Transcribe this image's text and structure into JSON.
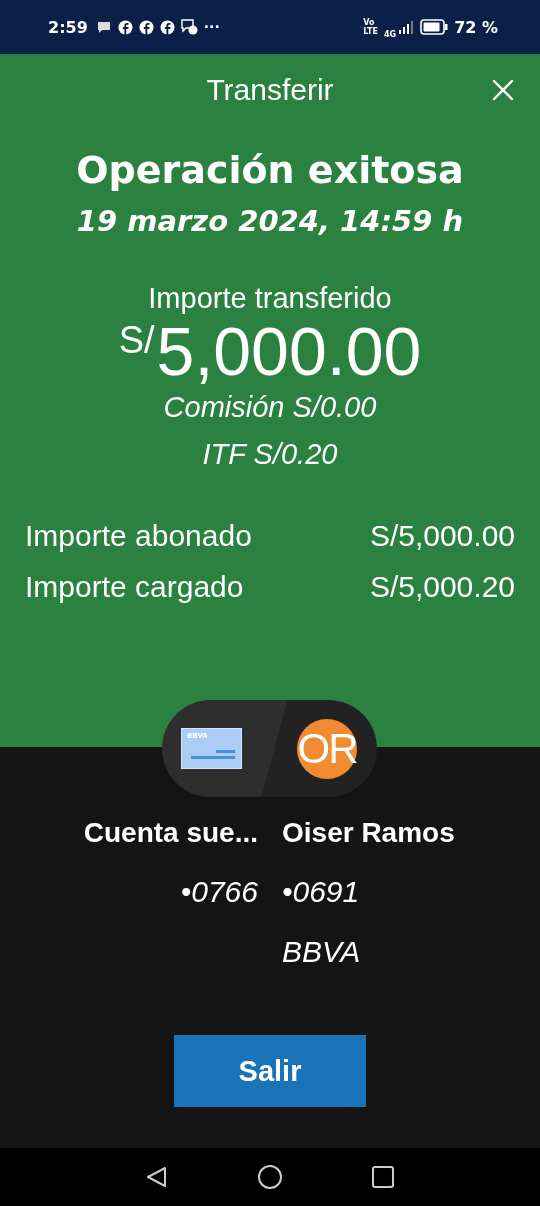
{
  "status_bar": {
    "time": "2:59",
    "more": "···",
    "volte_top": "Vo",
    "volte_bottom": "LTE",
    "network": "4G",
    "battery": "72 %"
  },
  "header": {
    "title": "Transferir"
  },
  "result": {
    "title": "Operación exitosa",
    "date": "19 marzo 2024, 14:59 h",
    "amount_label": "Importe transferido",
    "currency": "S/",
    "amount": "5,000.00",
    "commission": "Comisión S/0.00",
    "itf": "ITF S/0.20"
  },
  "summary": [
    {
      "label": "Importe abonado",
      "value": "S/5,000.00"
    },
    {
      "label": "Importe cargado",
      "value": "S/5,000.20"
    }
  ],
  "origin": {
    "card_brand": "BBVA",
    "name": "Cuenta sue...",
    "number": "•0766"
  },
  "destination": {
    "initials": "OR",
    "name": "Oiser Ramos",
    "number": "•0691",
    "bank": "BBVA"
  },
  "exit_button": "Salir"
}
